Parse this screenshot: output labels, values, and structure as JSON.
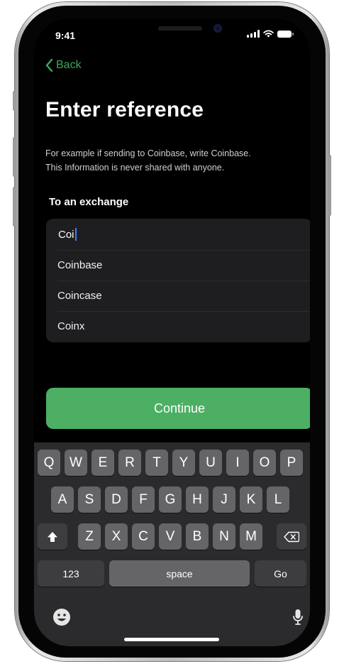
{
  "status_bar": {
    "time": "9:41"
  },
  "nav": {
    "back_label": "Back"
  },
  "title": "Enter reference",
  "description": [
    "For example if sending to Coinbase, write Coinbase.",
    "This Information is never shared with anyone."
  ],
  "section_label": "To an exchange",
  "input": {
    "value": "Coi"
  },
  "suggestions": [
    "Coinbase",
    "Coincase",
    "Coinx"
  ],
  "continue_label": "Continue",
  "keyboard": {
    "row1": [
      "Q",
      "W",
      "E",
      "R",
      "T",
      "Y",
      "U",
      "I",
      "O",
      "P"
    ],
    "row2": [
      "A",
      "S",
      "D",
      "F",
      "G",
      "H",
      "J",
      "K",
      "L"
    ],
    "row3": [
      "Z",
      "X",
      "C",
      "V",
      "B",
      "N",
      "M"
    ],
    "numbers_label": "123",
    "space_label": "space",
    "go_label": "Go"
  },
  "colors": {
    "accent": "#3ea95c",
    "button": "#4caf64",
    "background": "#000000"
  },
  "icons": [
    "chevron-left-icon",
    "signal-icon",
    "wifi-icon",
    "battery-icon",
    "shift-icon",
    "backspace-icon",
    "emoji-icon",
    "microphone-icon"
  ]
}
